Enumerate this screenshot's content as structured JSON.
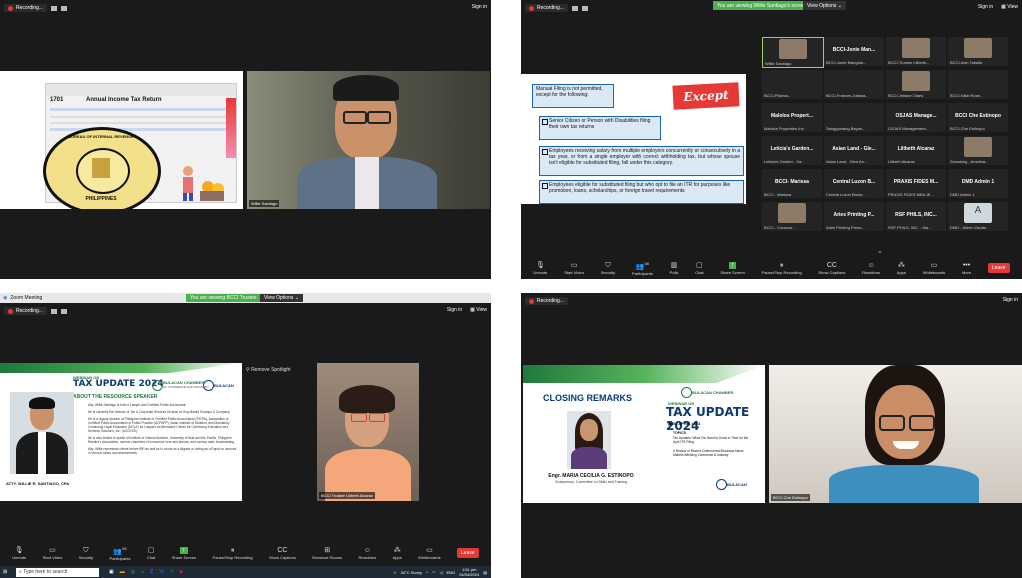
{
  "q1": {
    "recording": "Recording...",
    "sign_in": "Sign in",
    "form_number": "1701",
    "form_title": "Annual Income Tax Return",
    "seal_top": "BUREAU OF INTERNAL REVENUE",
    "seal_bottom": "PHILIPPINES",
    "speaker_name": "Willie Santiago"
  },
  "q2": {
    "recording": "Recording...",
    "banner": "You are viewing Willie Santiago's screen",
    "view_options": "View Options",
    "sign_in": "Sign in",
    "view": "View",
    "slide_box": "Manual Filing is not permitted, except for the following:",
    "except": "Except",
    "items": [
      "Senior Citizen or Person with Disabilities filing their own tax returns",
      "Employees receiving salary from multiple employers concurrently or consecutively in a tax year, or from a single employer with correct withholding tax, but whose spouse isn't eligible for substituted filing, fall under this category.",
      "Employees eligible for substituted filing but who opt to file an ITR for purposes like promotion, loans, scholarships, or foreign travel requirements"
    ],
    "tiles": [
      {
        "name": "",
        "sub": "Willie Santiago"
      },
      {
        "name": "BCCI-Jonie Man...",
        "sub": "BCCI-Jonie Manguia..."
      },
      {
        "name": "",
        "sub": "BCCI-Trustee Lilibeth..."
      },
      {
        "name": "",
        "sub": "BCCI-Irish Taballa"
      },
      {
        "name": "",
        "sub": "BCCI-Pilarica..."
      },
      {
        "name": "",
        "sub": "BCCI-Frances Juliana..."
      },
      {
        "name": "",
        "sub": "BCCI-Jellane Olaes"
      },
      {
        "name": "",
        "sub": "BCCI-Nikki Rose..."
      },
      {
        "name": "Malolos Propert...",
        "sub": "Malolos Properties Inc."
      },
      {
        "name": "",
        "sub": "Sangguniang Bayan..."
      },
      {
        "name": "OSJAS Manage...",
        "sub": "OSJAS Management..."
      },
      {
        "name": "BCCI Che Estinopo",
        "sub": "BCCI Che Estinopo"
      },
      {
        "name": "Leticia's Garden...",
        "sub": "Leticia's Garden - Sa..."
      },
      {
        "name": "Asian Land - Gle...",
        "sub": "Asian Land - Glen An..."
      },
      {
        "name": "Lilibeth Alcaraz",
        "sub": "Lilibeth Alcaraz"
      },
      {
        "name": "",
        "sub": "Snowking - Amelina..."
      },
      {
        "name": "BCCI- Marissa",
        "sub": "BCCI - Marissa"
      },
      {
        "name": "Central Luzon B...",
        "sub": "Central Luzon Busin..."
      },
      {
        "name": "PRAXIS FIDES M...",
        "sub": "PRAXIS FIDES MBA-IE..."
      },
      {
        "name": "DMD Admin 1",
        "sub": "DMD Admin 1"
      },
      {
        "name": "",
        "sub": "BCCI - Corazon..."
      },
      {
        "name": "Aries Printing P...",
        "sub": "Aries Printing Press..."
      },
      {
        "name": "RSF PHILS, INC...",
        "sub": "RSF PHILS, INC. - Ma..."
      },
      {
        "name": "A",
        "sub": "DMD - Aileen Zarate..."
      }
    ],
    "toolbar": {
      "unmute": "Unmute",
      "start_video": "Start Video",
      "security": "Security",
      "participants": "Participants",
      "participants_count": "56",
      "polls": "Polls",
      "chat": "Chat",
      "share": "Share Screen",
      "record": "Pause/Stop Recording",
      "captions": "Show Captions",
      "reactions": "Reactions",
      "apps": "Apps",
      "whiteboards": "Whiteboards",
      "more": "More",
      "leave": "Leave"
    }
  },
  "q3": {
    "zoom_title": "Zoom Meeting",
    "banner": "You are viewing BCCI Trustee",
    "view_options": "View Options",
    "recording": "Recording...",
    "sign_in": "Sign in",
    "view": "View",
    "webinar_on": "WEBINAR ON",
    "tax_update": "TAX UPDATE 2024",
    "chamber": "BULACAN CHAMBER",
    "chamber_sub": "OF COMMERCE AND INDUSTRY",
    "bulacan": "BULACAN",
    "about": "ABOUT THE RESOURCE SPEAKER",
    "bio1": "Atty. Willie Santiago is both a Lawyer and Certified Public Accountant.",
    "bio2": "He is currently the Director of Tax & Corporate Services Division of Ong Manila Ocampo & Company.",
    "bio3": "He is a regular lecturer at Philippine Institute of Certified Public Accountants (PICPA), Association of Certified Public Accountants in Public Practice (ACPAPP), Asian Institute of Taxation, and Mandatory Continuing Legal Education (MCLE) for Lawyers at Alternative Centre for Continuing Education and Seminar Solutions, Inc. (ACCESS).",
    "bio4": "He is also invited to speak at Institute of Internal Auditors, University of Asia and the Pacific, Philippine Retailer's Association, various chambers of commerce here and abroad, and various radio broadcasting.",
    "bio5": "Atty. Willie represents clients before BIR as well as in courts as a litigator or acting as a Rapid on account in Various cases and assessments.",
    "caption": "ATTY. WILLIE R. SANTIAGO, CPA",
    "remove_spotlight": "Remove Spotlight",
    "participant_name": "BCCI Trustee Lilibeth Alcaraz",
    "toolbar": {
      "unmute": "Unmute",
      "start_video": "Start Video",
      "security": "Security",
      "participants": "Participants",
      "participants_count": "56",
      "chat": "Chat",
      "share": "Share Screen",
      "record": "Pause/Stop Recording",
      "captions": "Show Captions",
      "breakout": "Breakout Rooms",
      "reactions": "Reactions",
      "apps": "Apps",
      "whiteboards": "Whiteboards",
      "leave": "Leave"
    },
    "taskbar": {
      "search": "Type here to search",
      "weather": "34°C Sunny",
      "lang": "ENG",
      "time": "1:51 pm",
      "date": "04/04/2024"
    }
  },
  "q4": {
    "recording": "Recording...",
    "sign_in": "Sign in",
    "closing": "CLOSING REMARKS",
    "speaker": "Engr. MARIA CECILIA G. ESTINOPO",
    "speaker_role": "Chairperson, Committee on Skills and Training",
    "chamber": "BULACAN CHAMBER",
    "webinar_on": "WEBINAR ON",
    "tax_update": "TAX UPDATE 2024",
    "date": "03 APRIL 2024",
    "topics_label": "TOPICS",
    "topic1": "Tax Updates: What You Need to Know in Time for the April ITR Filing",
    "topic2": "A Review of Recent Controversial Business Name Matters Affecting Commerce & Industry",
    "bulacan": "BULACAN",
    "participant_name": "BCCI Che Estinopo"
  },
  "colors": {
    "zoom_bg": "#1a1a1a",
    "green": "#4caf50",
    "leave_red": "#e53935",
    "slide_green": "#1e7a3c",
    "slide_blue": "#0b3a75"
  }
}
